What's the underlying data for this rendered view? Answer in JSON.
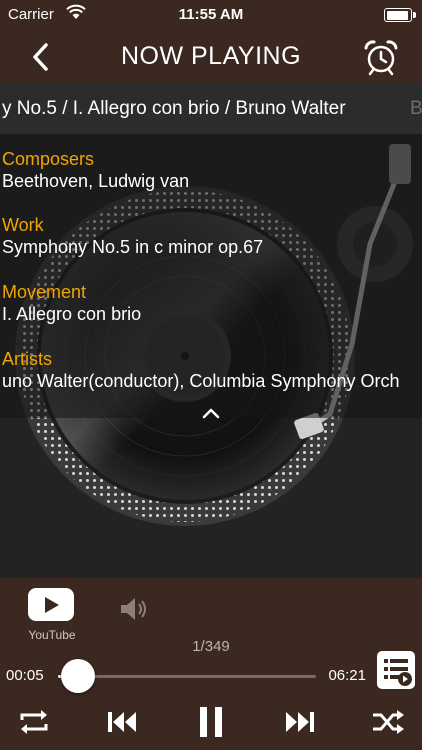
{
  "status_bar": {
    "carrier": "Carrier",
    "time": "11:55 AM"
  },
  "nav": {
    "title": "NOW PLAYING",
    "back_icon": "chevron-left-icon",
    "alarm_icon": "alarm-clock-icon"
  },
  "now_playing": {
    "scrolling_title": "y No.5 / I. Allegro con brio / Bruno Walter",
    "scrolling_next": "B"
  },
  "info": {
    "composers_label": "Composers",
    "composers_value": "Beethoven, Ludwig van",
    "work_label": "Work",
    "work_value": "Symphony No.5 in c minor op.67",
    "movement_label": "Movement",
    "movement_value": "I. Allegro con brio",
    "artists_label": "Artists",
    "artists_value": "uno Walter(conductor), Columbia Symphony Orch"
  },
  "player": {
    "youtube_label": "YouTube",
    "track_position": "1/349",
    "elapsed": "00:05",
    "duration": "06:21",
    "progress_fraction": 0.013
  },
  "colors": {
    "brand_brown": "#3b2820",
    "accent_orange": "#f0a500",
    "background": "#232323"
  }
}
